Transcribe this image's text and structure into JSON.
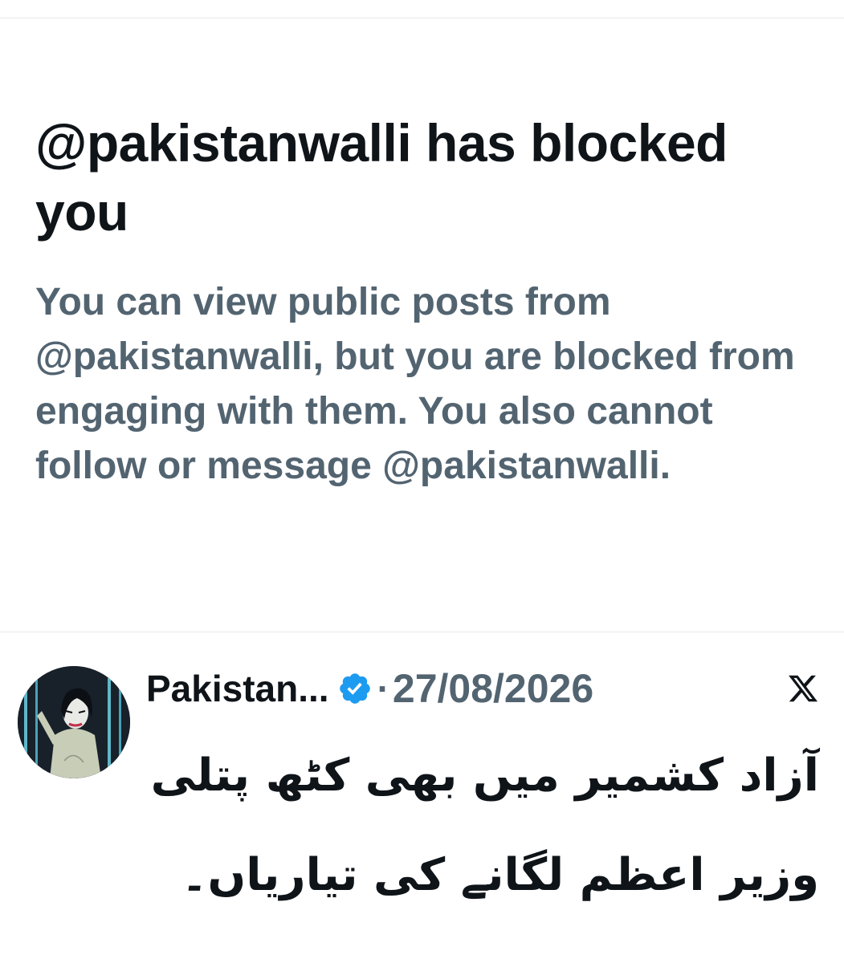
{
  "blocked_notice": {
    "title": "@pakistanwalli has blocked you",
    "description": "You can view public posts from @pakistanwalli, but you are blocked from engaging with them. You also cannot follow or message @pakistanwalli."
  },
  "post": {
    "author_name": "Pakistan...",
    "separator": "·",
    "date": "27/08/2026",
    "verified_icon": "verified-badge-icon",
    "platform_icon": "x-logo-icon",
    "text": "آزاد کشمیر میں بھی کٹھ پتلی وزیر اعظم لگانے کی تیاریاں۔"
  },
  "colors": {
    "primary_text": "#0f1419",
    "secondary_text": "#536471",
    "verified_blue": "#1d9bf0",
    "divider": "#e6e9ec"
  }
}
